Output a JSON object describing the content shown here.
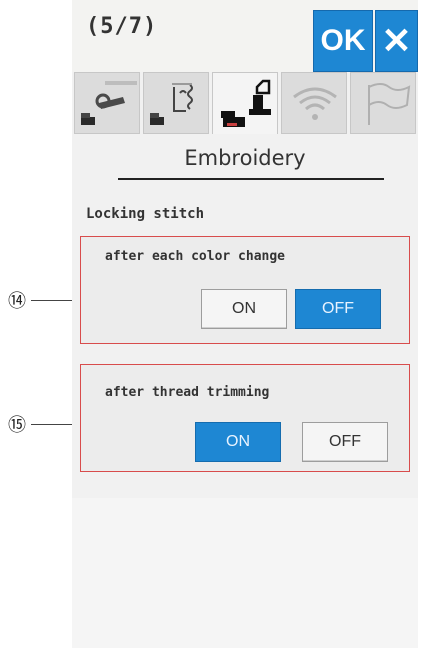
{
  "header": {
    "page_indicator": "(5/7)",
    "ok_label": "OK",
    "close_label": "✕"
  },
  "tabs": [
    {
      "name": "machine-settings",
      "icon": "wrench-icon",
      "active": false
    },
    {
      "name": "sewing-settings",
      "icon": "stitch-icon",
      "active": false
    },
    {
      "name": "embroidery-settings",
      "icon": "embroidery-machine-icon",
      "active": true
    },
    {
      "name": "wireless-settings",
      "icon": "wifi-icon",
      "active": false
    },
    {
      "name": "language-settings",
      "icon": "flag-icon",
      "active": false
    }
  ],
  "main": {
    "title": "Embroidery",
    "section_label": "Locking stitch",
    "groups": [
      {
        "callout": "⑭",
        "label": "after each color change",
        "on_label": "ON",
        "off_label": "OFF",
        "selected": "OFF"
      },
      {
        "callout": "⑮",
        "label": "after thread trimming",
        "on_label": "ON",
        "off_label": "OFF",
        "selected": "ON"
      }
    ]
  },
  "colors": {
    "accent": "#1e87d3",
    "highlight_border": "#d84c4c"
  }
}
